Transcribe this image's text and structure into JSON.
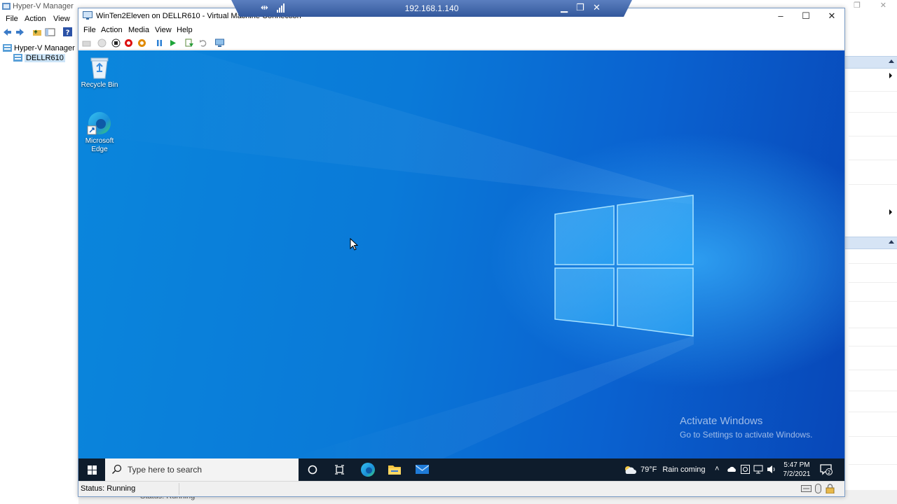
{
  "hyperv_manager": {
    "title": "Hyper-V Manager",
    "menu": [
      "File",
      "Action",
      "View"
    ],
    "tree": {
      "root": "Hyper-V Manager",
      "server": "DELLR610"
    },
    "status": "Status: Running"
  },
  "remote_bar": {
    "host": "192.168.1.140"
  },
  "vm_window": {
    "title": "WinTen2Eleven on DELLR610 - Virtual Machine Connection",
    "menu": [
      "File",
      "Action",
      "Media",
      "View",
      "Help"
    ]
  },
  "desktop": {
    "icons": [
      {
        "label": "Recycle Bin",
        "icon": "recycle-bin-icon"
      },
      {
        "label": "Microsoft Edge",
        "icon": "edge-icon"
      }
    ],
    "watermark": {
      "line1": "Activate Windows",
      "line2": "Go to Settings to activate Windows."
    }
  },
  "taskbar": {
    "search_placeholder": "Type here to search",
    "weather_temp": "79°F",
    "weather_text": "Rain coming",
    "time": "5:47 PM",
    "date": "7/2/2021",
    "notification_count": "2"
  },
  "vm_status": {
    "text": "Status: Running"
  },
  "colors": {
    "desktop_blue": "#0a7ad8",
    "taskbar": "#0e1c2c",
    "remote_bar": "#3b63a6"
  }
}
